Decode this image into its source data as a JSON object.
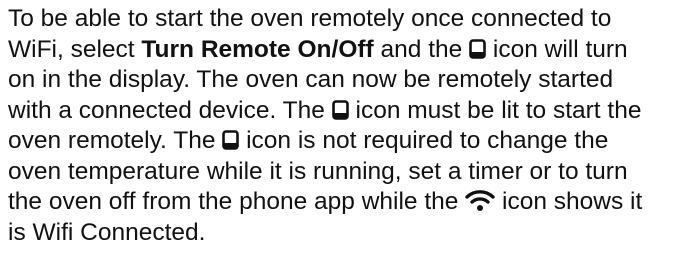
{
  "paragraph": {
    "l1": "To be able to start the oven remotely once connected to",
    "l2_a": "WiFi, select ",
    "l2_bold": "Turn Remote On/Off",
    "l2_b": " and the ",
    "l2_c": " icon will turn",
    "l3": "on in the display. The oven can now be remotely started",
    "l4_a": "with a connected device. The ",
    "l4_b": " icon must be lit to start the",
    "l5_a": "oven remotely. The ",
    "l5_b": " icon is not required to change the",
    "l6": "oven temperature while it is running, set a timer or to turn",
    "l7_a": "the oven off from the phone app while the ",
    "l7_b": " icon shows it",
    "l8": "is Wifi Connected."
  },
  "icons": {
    "remote": "phone-remote-icon",
    "wifi": "wifi-icon"
  }
}
